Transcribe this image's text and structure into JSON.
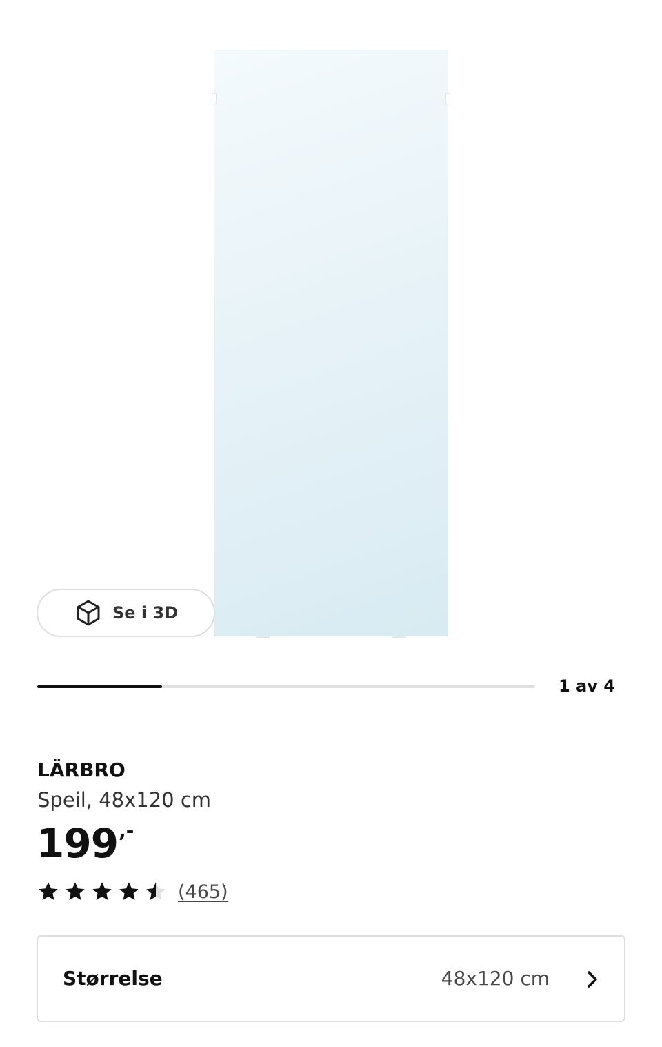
{
  "product_image": {
    "alt": "LÄRBRO Speil, 48x120 cm",
    "view_3d_label": "Se i 3D",
    "view_3d_icon": "cube-icon"
  },
  "gallery": {
    "current": 1,
    "total": 4,
    "progress_fraction": 0.25,
    "counter_text": "1 av 4"
  },
  "product": {
    "name": "LÄRBRO",
    "description": "Speil, 48x120 cm",
    "price_main": "199",
    "price_suffix": ",-",
    "rating": 4.5,
    "rating_max": 5,
    "review_count": "(465)"
  },
  "size_selector": {
    "label": "Størrelse",
    "value": "48x120 cm",
    "icon": "chevron-right-icon"
  },
  "colors": {
    "text_primary": "#111111",
    "text_secondary": "#484848",
    "border": "#dfdfdf",
    "progress_active": "#111111",
    "mirror_tint": "#e2f0f6"
  }
}
